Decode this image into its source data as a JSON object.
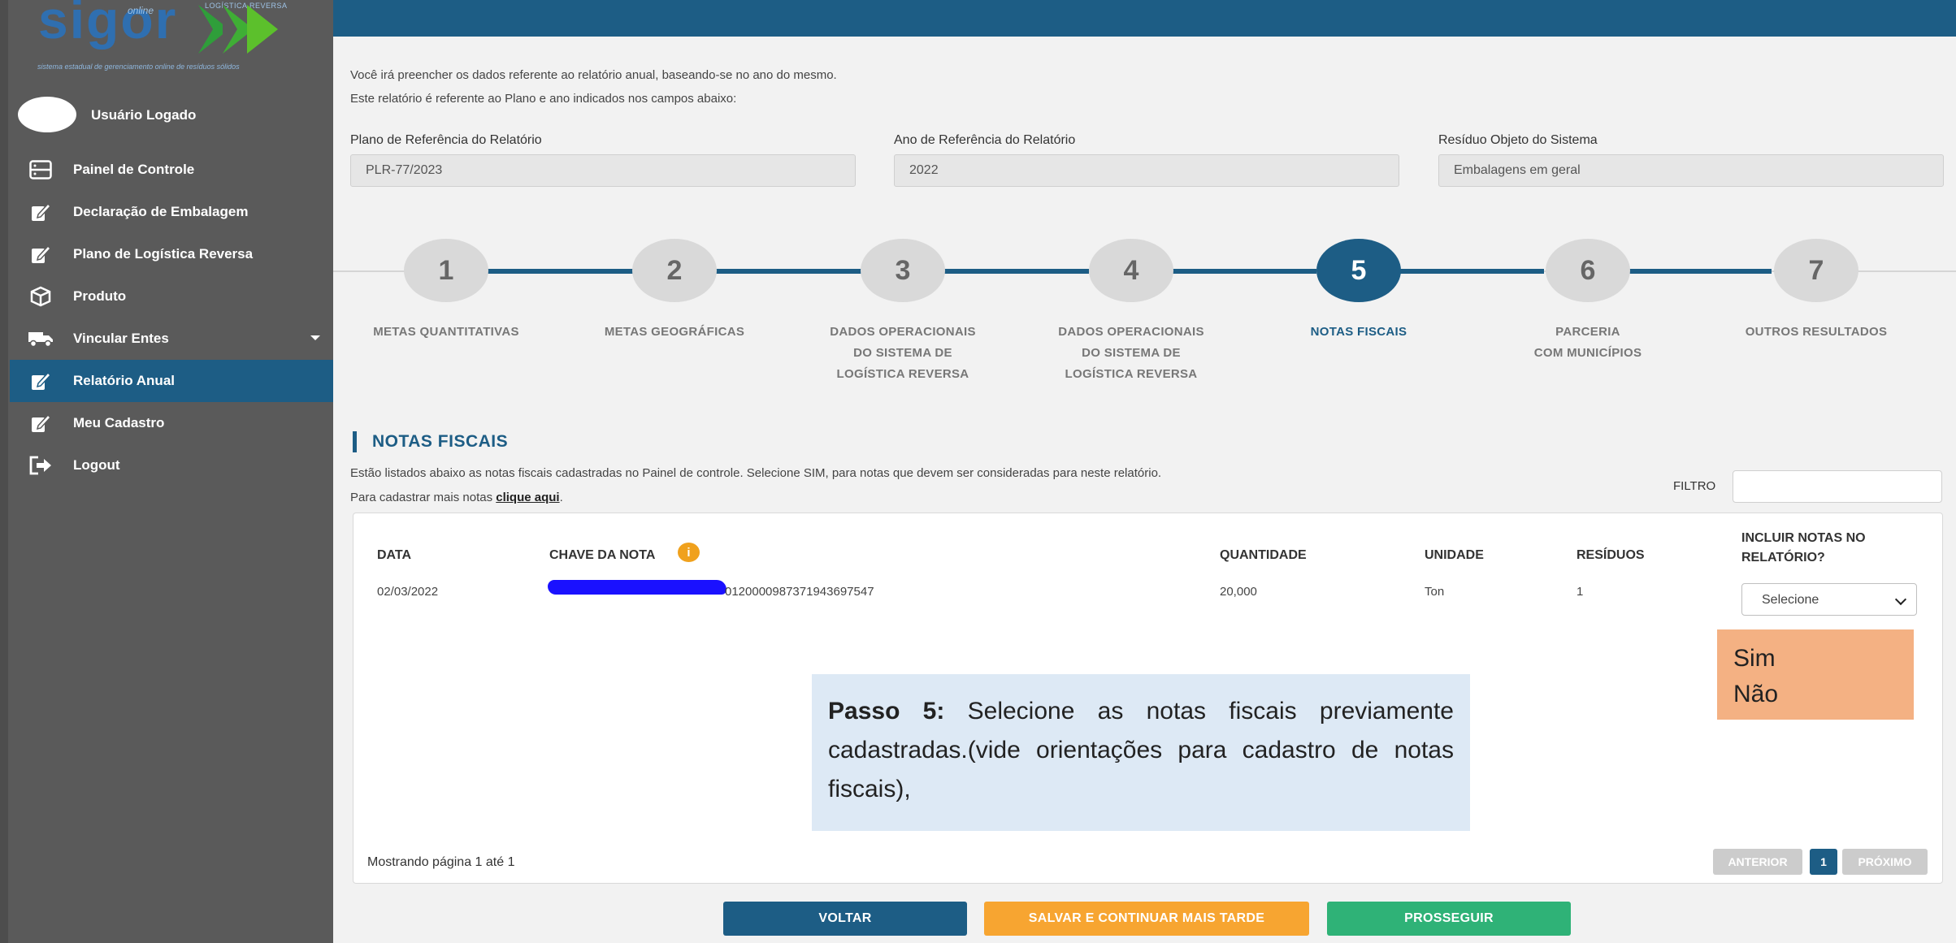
{
  "logo": {
    "text": "sigor",
    "online": "online",
    "top_caption": "LOGÍSTICA REVERSA",
    "subtitle": "sistema estadual de gerenciamento online de resíduos sólidos"
  },
  "user": {
    "name": "Usuário Logado"
  },
  "sidebar": {
    "items": [
      {
        "label": "Painel de Controle",
        "icon": "dashboard-icon"
      },
      {
        "label": "Declaração de Embalagem",
        "icon": "edit-icon"
      },
      {
        "label": "Plano de Logística Reversa",
        "icon": "edit-icon"
      },
      {
        "label": "Produto",
        "icon": "box-icon"
      },
      {
        "label": "Vincular Entes",
        "icon": "truck-icon"
      },
      {
        "label": "Relatório Anual",
        "icon": "edit-icon",
        "active": true
      },
      {
        "label": "Meu Cadastro",
        "icon": "edit-icon"
      },
      {
        "label": "Logout",
        "icon": "logout-icon"
      }
    ]
  },
  "intro": {
    "line1": "Você irá preencher os dados referente ao relatório anual, baseando-se no ano do mesmo.",
    "line2": "Este relatório é referente ao Plano e ano indicados nos campos abaixo:"
  },
  "fields": {
    "plano": {
      "label": "Plano de Referência do Relatório",
      "value": "PLR-77/2023"
    },
    "ano": {
      "label": "Ano de Referência do Relatório",
      "value": "2022"
    },
    "residuo": {
      "label": "Resíduo Objeto do Sistema",
      "value": "Embalagens em geral"
    }
  },
  "steps": [
    {
      "num": "1",
      "label": "METAS QUANTITATIVAS"
    },
    {
      "num": "2",
      "label": "METAS GEOGRÁFICAS"
    },
    {
      "num": "3",
      "label1": "DADOS OPERACIONAIS",
      "label2": "DO SISTEMA DE",
      "label3": "LOGÍSTICA REVERSA"
    },
    {
      "num": "4",
      "label1": "DADOS OPERACIONAIS",
      "label2": "DO SISTEMA DE",
      "label3": "LOGÍSTICA REVERSA"
    },
    {
      "num": "5",
      "label": "NOTAS FISCAIS",
      "active": true
    },
    {
      "num": "6",
      "label1": "PARCERIA",
      "label2": "COM MUNICÍPIOS"
    },
    {
      "num": "7",
      "label": "OUTROS RESULTADOS"
    }
  ],
  "section": {
    "title": "NOTAS FISCAIS",
    "desc1": "Estão listados abaixo as notas fiscais cadastradas no Painel de controle. Selecione SIM, para notas que devem ser consideradas para neste relatório.",
    "desc2_prefix": "Para cadastrar mais notas ",
    "desc2_link": "clique aqui",
    "desc2_suffix": "."
  },
  "filter": {
    "label": "FILTRO",
    "value": ""
  },
  "table": {
    "headers": {
      "data": "DATA",
      "chave": "CHAVE DA NOTA",
      "quantidade": "QUANTIDADE",
      "unidade": "UNIDADE",
      "residuos": "RESÍDUOS",
      "incluir1": "INCLUIR NOTAS NO",
      "incluir2": "RELATÓRIO?"
    },
    "rows": [
      {
        "data": "02/03/2022",
        "chave": "0120000987371943697547",
        "quantidade": "20,000",
        "unidade": "Ton",
        "residuos": "1",
        "incluir": "Selecione"
      }
    ]
  },
  "dropdown": {
    "options": [
      "Sim",
      "Não"
    ]
  },
  "callout": {
    "bold": "Passo 5:",
    "text": " Selecione as notas fiscais previamente cadastradas.(vide orientações para cadastro de notas fiscais),"
  },
  "pagination": {
    "info": "Mostrando página 1 até 1",
    "prev": "ANTERIOR",
    "current": "1",
    "next": "PRÓXIMO"
  },
  "actions": {
    "back": "VOLTAR",
    "save": "SALVAR E CONTINUAR MAIS TARDE",
    "next": "PROSSEGUIR"
  },
  "colors": {
    "primary": "#1d5d85",
    "sidebar": "#5a5a5a",
    "save": "#f7a531",
    "proceed": "#2fb277",
    "callout": "#dde9f5",
    "dropdown": "#f4b183",
    "info": "#f0a11d"
  }
}
